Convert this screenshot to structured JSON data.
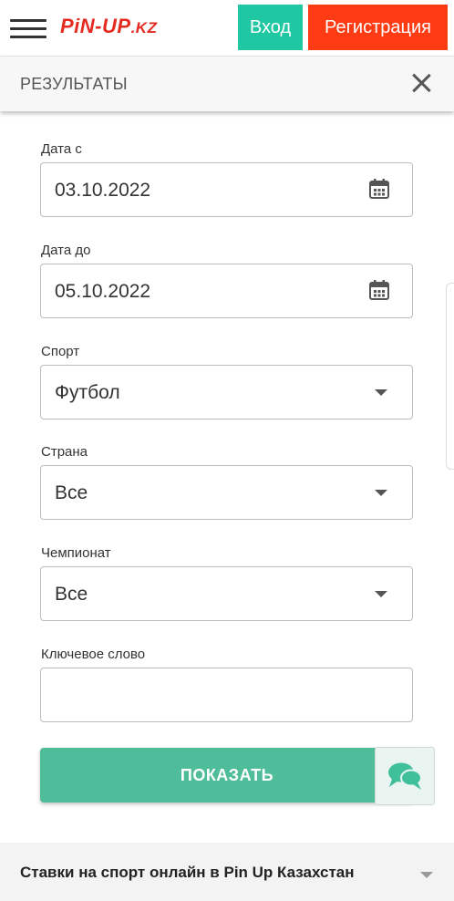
{
  "header": {
    "logo": {
      "main": "PiN-UP",
      "suffix": ".KZ"
    },
    "login_label": "Вход",
    "register_label": "Регистрация"
  },
  "page": {
    "title": "РЕЗУЛЬТАТЫ"
  },
  "form": {
    "date_from": {
      "label": "Дата с",
      "value": "03.10.2022"
    },
    "date_to": {
      "label": "Дата до",
      "value": "05.10.2022"
    },
    "sport": {
      "label": "Спорт",
      "value": "Футбол"
    },
    "country": {
      "label": "Страна",
      "value": "Все"
    },
    "championship": {
      "label": "Чемпионат",
      "value": "Все"
    },
    "keyword": {
      "label": "Ключевое слово",
      "value": ""
    },
    "show_label": "ПОКАЗАТЬ"
  },
  "footer": {
    "text": "Ставки на спорт онлайн в Pin Up Казахстан"
  },
  "icons": {
    "menu": "hamburger-menu-icon",
    "close": "close-icon",
    "calendar": "calendar-icon",
    "dropdown": "caret-down-icon",
    "chat": "chat-bubbles-icon"
  },
  "colors": {
    "brand_red": "#e32b21",
    "login_green": "#1fc7a2",
    "register_red": "#ff3b13",
    "show_button": "#4fbd99",
    "chat_icon": "#3fbf9a"
  }
}
